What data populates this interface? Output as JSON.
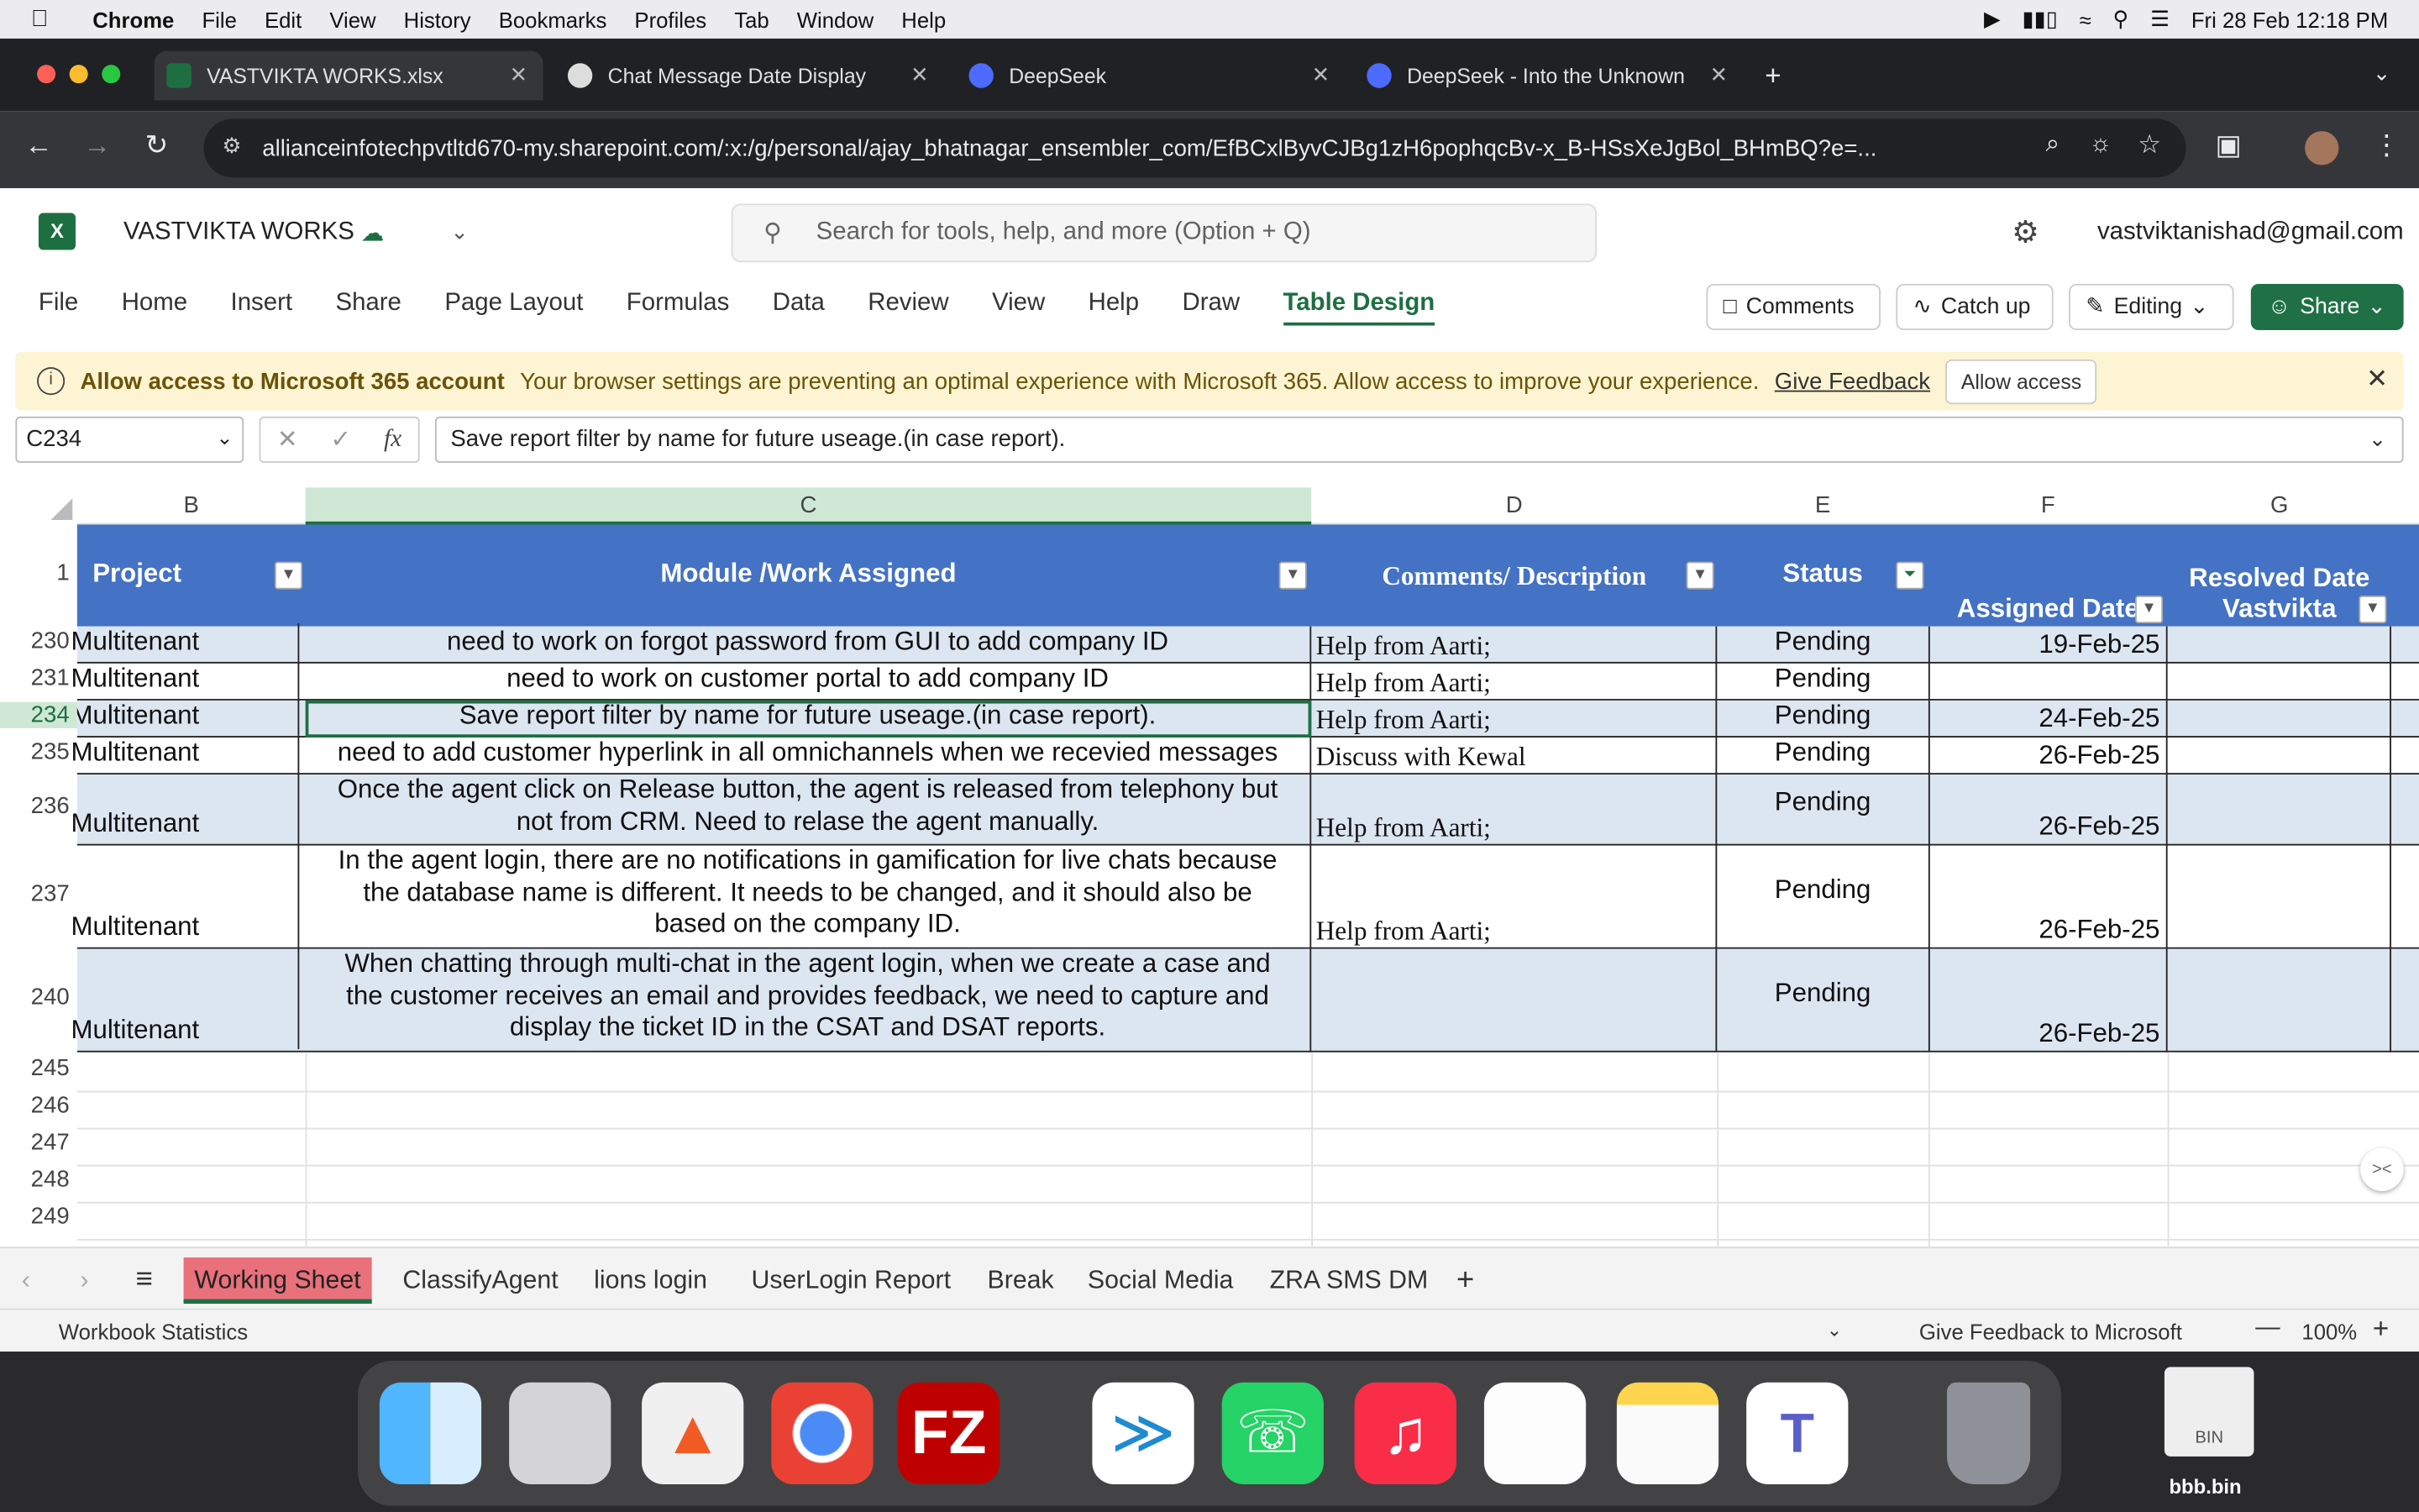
{
  "menubar": {
    "app": "Chrome",
    "items": [
      "File",
      "Edit",
      "View",
      "History",
      "Bookmarks",
      "Profiles",
      "Tab",
      "Window",
      "Help"
    ],
    "datetime": "Fri 28 Feb  12:18 PM"
  },
  "tabs": [
    {
      "title": "VASTVIKTA WORKS.xlsx",
      "color": "#1d6f42"
    },
    {
      "title": "Chat Message Date Display",
      "color": "#dddddd"
    },
    {
      "title": "DeepSeek",
      "color": "#4d6bfe"
    },
    {
      "title": "DeepSeek - Into the Unknown",
      "color": "#4d6bfe"
    }
  ],
  "url": "allianceinfotechpvtltd670-my.sharepoint.com/:x:/g/personal/ajay_bhatnagar_ensembler_com/EfBCxlByvCJBg1zH6pophqcBv-x_B-HSsXeJgBol_BHmBQ?e=...",
  "excel": {
    "doc_name": "VASTVIKTA WORKS",
    "search_placeholder": "Search for tools, help, and more (Option + Q)",
    "account": "vastviktanishad@gmail.com",
    "ribbon_tabs": [
      "File",
      "Home",
      "Insert",
      "Share",
      "Page Layout",
      "Formulas",
      "Data",
      "Review",
      "View",
      "Help",
      "Draw",
      "Table Design"
    ],
    "buttons": {
      "comments": "Comments",
      "catchup": "Catch up",
      "editing": "Editing",
      "share": "Share"
    }
  },
  "banner": {
    "title": "Allow access to Microsoft 365 account",
    "message": "Your browser settings are preventing an optimal experience with Microsoft 365. Allow access to improve your experience.",
    "feedback": "Give Feedback",
    "allow": "Allow access"
  },
  "formula": {
    "cell_ref": "C234",
    "fx": "fx",
    "content": "Save report filter by name for future useage.(in case report)."
  },
  "columns": [
    "B",
    "C",
    "D",
    "E",
    "F",
    "G"
  ],
  "headers": {
    "project": "Project",
    "module": "Module /Work Assigned",
    "comments": "Comments/ Description",
    "status": "Status",
    "assigned": "Assigned Date",
    "resolved": "Resolved Date Vastvikta"
  },
  "rows": [
    {
      "num": "230",
      "project": "Multitenant",
      "module": [
        "need to work on forgot password from GUI to add company ID"
      ],
      "comment": "Help from Aarti;",
      "status": "Pending",
      "assigned": "19-Feb-25"
    },
    {
      "num": "231",
      "project": "Multitenant",
      "module": [
        "need to work on customer portal to add company ID"
      ],
      "comment": "Help from Aarti;",
      "status": "Pending",
      "assigned": ""
    },
    {
      "num": "234",
      "project": "Multitenant",
      "module": [
        "Save report filter by name for future useage.(in case report)."
      ],
      "comment": "Help from Aarti;",
      "status": "Pending",
      "assigned": "24-Feb-25"
    },
    {
      "num": "235",
      "project": "Multitenant",
      "module": [
        "need to add customer hyperlink in all omnichannels when we recevied messages"
      ],
      "comment": "Discuss with Kewal",
      "status": "Pending",
      "assigned": "26-Feb-25"
    },
    {
      "num": "236",
      "project": "Multitenant",
      "module": [
        "Once the agent click on Release button, the agent is released from telephony but",
        "not from CRM. Need to relase the agent manually."
      ],
      "comment": "Help from Aarti;",
      "status": "Pending",
      "assigned": "26-Feb-25"
    },
    {
      "num": "237",
      "project": "Multitenant",
      "module": [
        "In the agent login, there are no notifications in gamification for live chats because",
        "the database name is different. It needs to be changed, and it should also be",
        "based on the company ID."
      ],
      "comment": "Help from Aarti;",
      "status": "Pending",
      "assigned": "26-Feb-25"
    },
    {
      "num": "240",
      "project": "Multitenant",
      "module": [
        "When chatting through multi-chat in the agent login, when we create a case and",
        "the customer receives an email and provides feedback, we need to capture and",
        "display the ticket ID in the CSAT and DSAT reports."
      ],
      "comment": "",
      "status": "Pending",
      "assigned": "26-Feb-25"
    }
  ],
  "empty_rows": [
    "245",
    "246",
    "247",
    "248",
    "249"
  ],
  "sheets": [
    "Working Sheet",
    "ClassifyAgent",
    "lions login",
    "UserLogin Report",
    "Break",
    "Social Media",
    "ZRA SMS DM"
  ],
  "status_bar": {
    "left": "Workbook Statistics",
    "feedback": "Give Feedback to Microsoft",
    "zoom": "100%"
  },
  "dock": {
    "apps": [
      "Finder",
      "Launchpad",
      "Brave",
      "Chrome",
      "FileZilla",
      "VS Code",
      "WhatsApp",
      "Music",
      "TextEdit",
      "Notes",
      "Teams",
      "Trash"
    ],
    "bin_label": "BIN",
    "file_label": "bbb.bin"
  }
}
